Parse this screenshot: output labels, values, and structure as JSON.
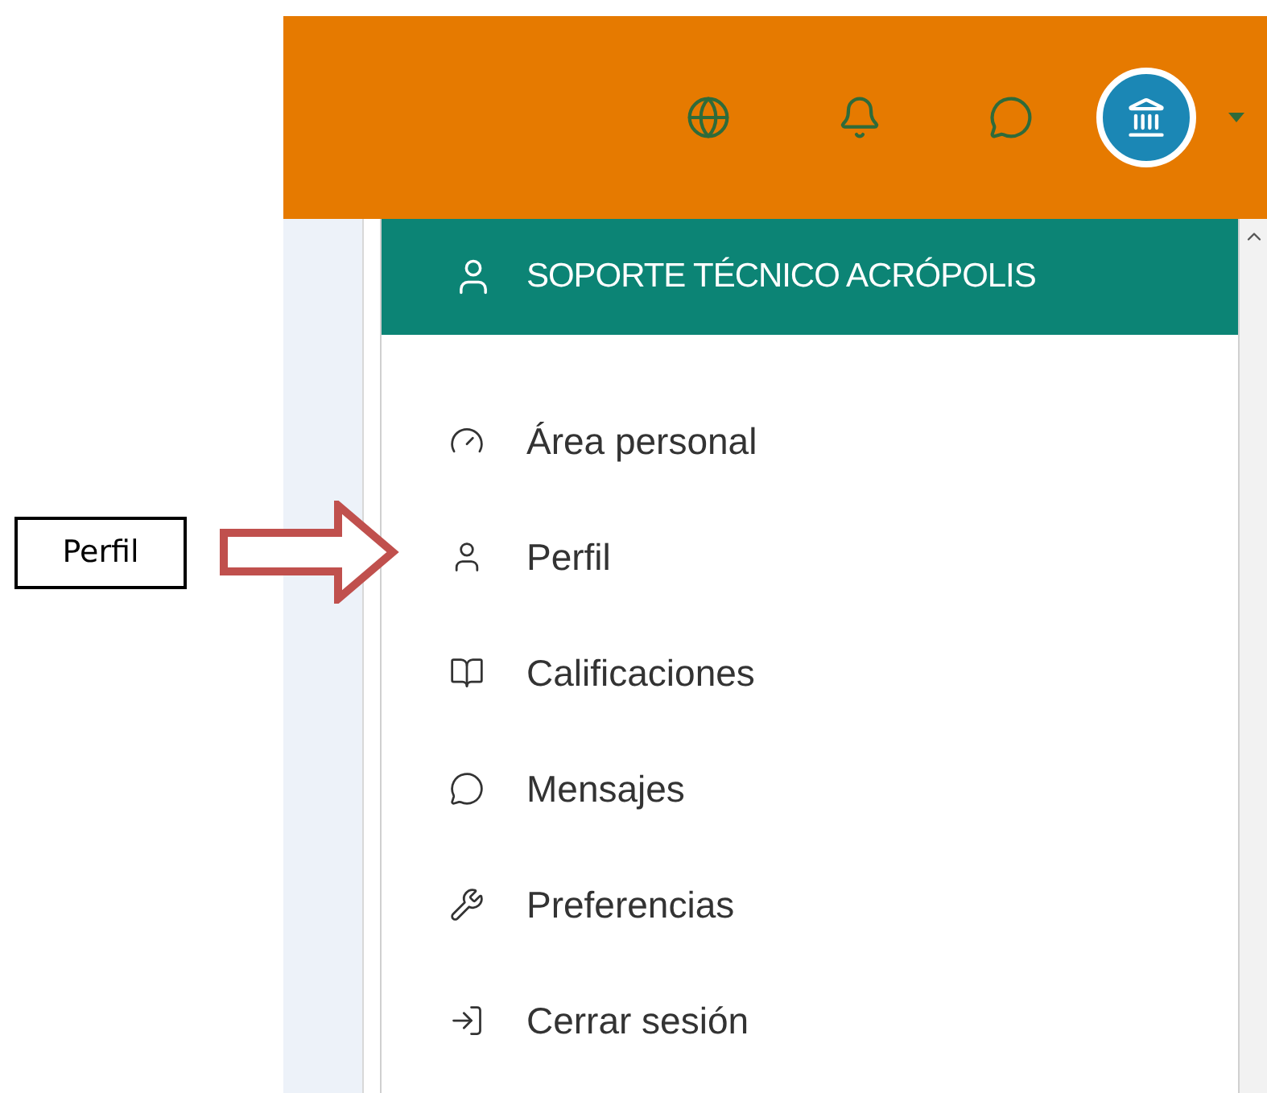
{
  "annotation": {
    "label": "Perfil"
  },
  "header": {
    "icons": [
      {
        "kind": "globe"
      },
      {
        "kind": "bell"
      },
      {
        "kind": "chat"
      }
    ]
  },
  "menu": {
    "title": "SOPORTE TÉCNICO ACRÓPOLIS",
    "items": [
      {
        "kind": "dashboard",
        "label": "Área personal"
      },
      {
        "kind": "profile",
        "label": "Perfil"
      },
      {
        "kind": "grades",
        "label": "Calificaciones"
      },
      {
        "kind": "messages",
        "label": "Mensajes"
      },
      {
        "kind": "preferences",
        "label": "Preferencias"
      },
      {
        "kind": "logout",
        "label": "Cerrar sesión"
      }
    ]
  }
}
